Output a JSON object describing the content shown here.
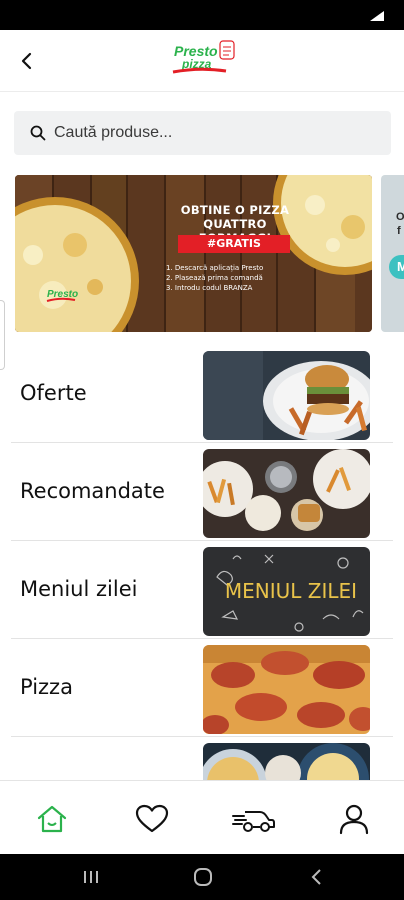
{
  "app": {
    "logo_text_1": "Presto",
    "logo_text_2": "pizza",
    "brand_color": "#e31f26",
    "accent_color": "#2bb24c"
  },
  "header": {
    "back_icon": "chevron-left-icon"
  },
  "search": {
    "placeholder": "Caută produse...",
    "value": "",
    "icon": "search-icon"
  },
  "banner": {
    "headline_1": "OBTINE O PIZZA",
    "headline_2": "QUATTRO FORMAGGI",
    "tag": "#GRATIS",
    "steps": [
      "1. Descarcă aplicația Presto",
      "2. Plasează prima comandă",
      "3. Introdu codul BRANZA"
    ],
    "peek_1": "O",
    "peek_2": "f",
    "peek_badge": "M"
  },
  "categories": [
    {
      "label": "Oferte",
      "image": "burger-fries"
    },
    {
      "label": "Recomandate",
      "image": "table-meal"
    },
    {
      "label": "Meniul zilei",
      "image": "chalkboard",
      "image_text": "MENIUL ZILEI"
    },
    {
      "label": "Pizza",
      "image": "pepperoni-pizza"
    },
    {
      "label": "",
      "image": "pasta-plates"
    }
  ],
  "bottom_nav": [
    {
      "name": "home",
      "icon": "home-icon",
      "active": true
    },
    {
      "name": "favorites",
      "icon": "heart-icon",
      "active": false
    },
    {
      "name": "delivery",
      "icon": "delivery-car-icon",
      "active": false
    },
    {
      "name": "account",
      "icon": "user-icon",
      "active": false
    }
  ]
}
